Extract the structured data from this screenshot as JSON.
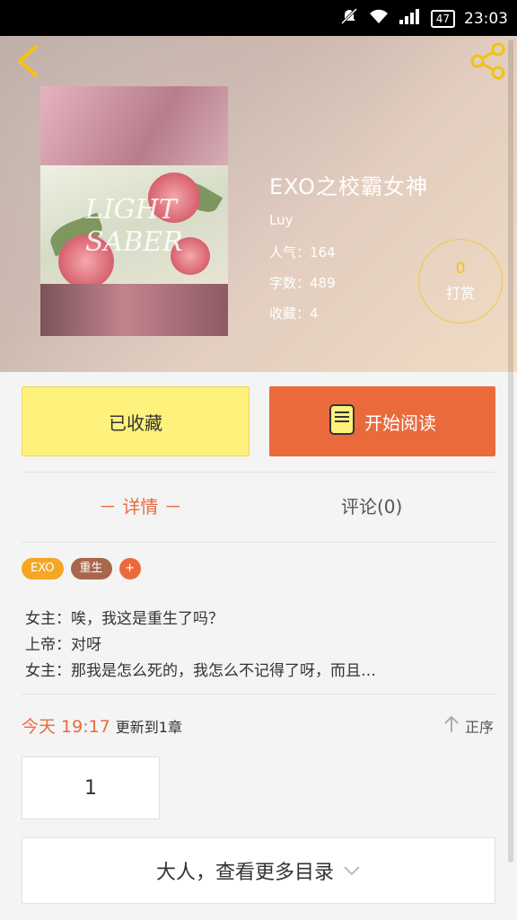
{
  "status_bar": {
    "battery": "47",
    "time": "23:03"
  },
  "book": {
    "title": "EXO之校霸女神",
    "author": "Luy",
    "popularity": "人气：164",
    "word_count": "字数：489",
    "favorites": "收藏：4",
    "cover_text": [
      "LIGHT",
      "SABER"
    ]
  },
  "reward": {
    "count": "0",
    "label": "打赏"
  },
  "actions": {
    "favorited_label": "已收藏",
    "read_label": "开始阅读"
  },
  "tabs": {
    "detail": "－ 详情 －",
    "comments": "评论(0)"
  },
  "tags": [
    "EXO",
    "重生",
    "+"
  ],
  "description": [
    "女主：唉，我这是重生了吗？",
    "上帝：对呀",
    "女主：那我是怎么死的，我怎么不记得了呀，而且…"
  ],
  "update": {
    "date": "今天 19:17",
    "text": "更新到1章"
  },
  "order_label": "正序",
  "chapter": "1",
  "more_catalog": "大人，查看更多目录",
  "colors": {
    "accent": "#ea6a3c",
    "favorite_bg": "#fef17c",
    "icon_yellow": "#f1c40f"
  },
  "icons": [
    "back-icon",
    "share-icon",
    "book-icon",
    "arrow-up-icon",
    "chevron-down-icon",
    "signal-icon",
    "wifi-icon",
    "mute-icon"
  ]
}
